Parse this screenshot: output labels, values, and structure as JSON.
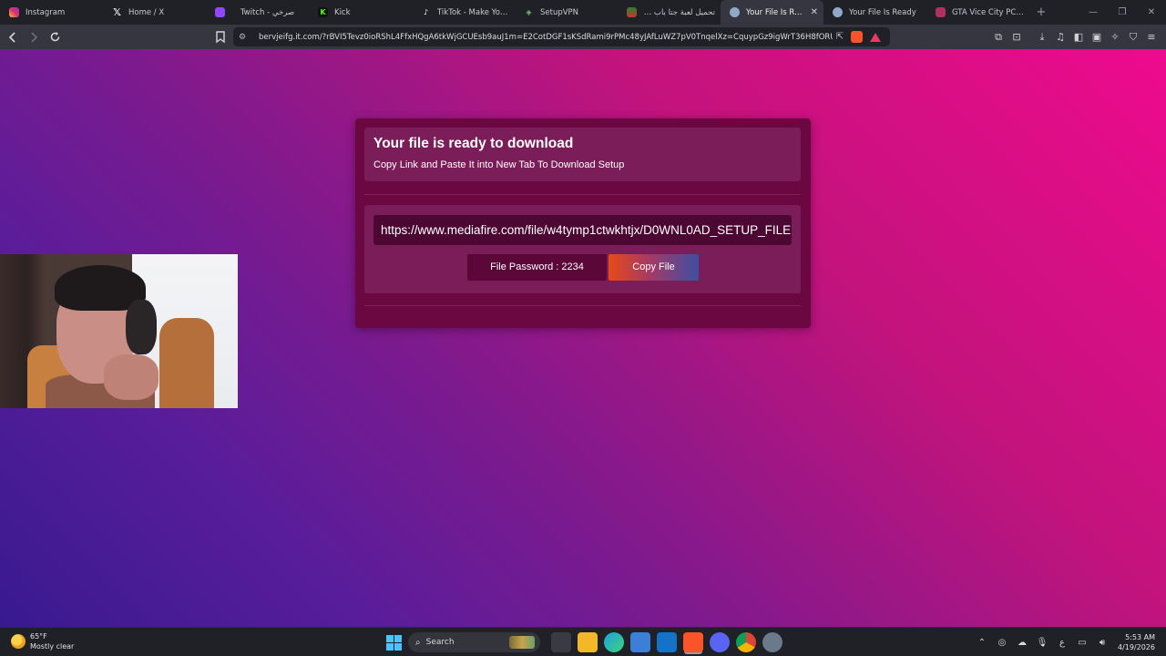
{
  "browser": {
    "tabs": [
      {
        "title": "Instagram",
        "icon": "instagram-icon",
        "color": "#d6249f",
        "active": false
      },
      {
        "title": "Home / X",
        "icon": "x-icon",
        "color": "#000000",
        "active": false
      },
      {
        "title": "Twitch - صرخي",
        "icon": "twitch-icon",
        "color": "#9146ff",
        "active": false
      },
      {
        "title": "Kick",
        "icon": "kick-icon",
        "color": "#53fc18",
        "active": false
      },
      {
        "title": "TikTok - Make Your Da",
        "icon": "tiktok-icon",
        "color": "#111111",
        "active": false
      },
      {
        "title": "SetupVPN",
        "icon": "setupvpn-icon",
        "color": "#2e7d32",
        "active": false
      },
      {
        "title": "تحميل لعبة جتا باب الحا",
        "icon": "site-icon",
        "color": "#c0392b",
        "active": false
      },
      {
        "title": "Your File Is Ready",
        "icon": "globe-icon",
        "color": "#8fa8c8",
        "active": true
      },
      {
        "title": "Your File Is Ready",
        "icon": "globe-icon",
        "color": "#8fa8c8",
        "active": false
      },
      {
        "title": "GTA Vice City PC | Dov",
        "icon": "site-icon",
        "color": "#b03060",
        "active": false
      }
    ],
    "url": "bervjeifg.it.com/?rBVI5Tevz0ioRShL4FfxHQgA6tkWjGCUEsb9auJ1m=E2CotDGF1sKSdRami9rPMc48yJAfLuWZ7pV0TnqelXz=CquypGz9igWrT36H8fORU..."
  },
  "page": {
    "title": "Your file is ready to download",
    "subtitle": "Copy Link and Paste It into New Tab To Download Setup",
    "link": "https://www.mediafire.com/file/w4tymp1ctwkhtjx/D0WNL0AD_SETUP_FILE",
    "password_label": "File Password : 2234",
    "copy_button": "Copy File"
  },
  "taskbar": {
    "temperature": "65°F",
    "weather": "Mostly clear",
    "search_label": "Search",
    "time": "5:53 AM",
    "date": "4/19/2026",
    "lang": "ع"
  }
}
